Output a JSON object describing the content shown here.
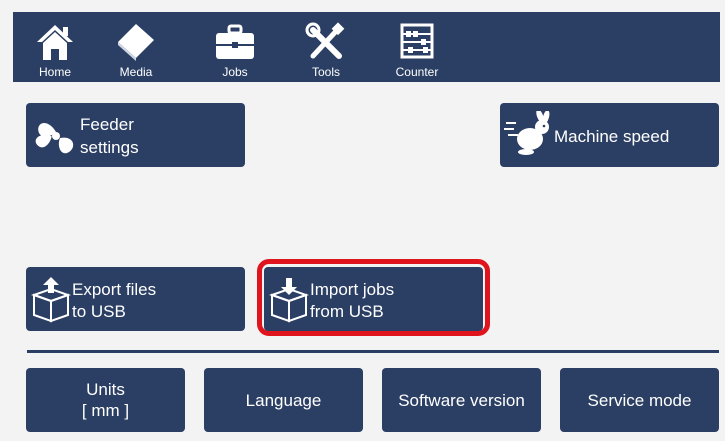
{
  "nav": {
    "home": "Home",
    "media": "Media",
    "jobs": "Jobs",
    "tools": "Tools",
    "counter": "Counter"
  },
  "buttons": {
    "feeder": {
      "line1": "Feeder",
      "line2": "settings"
    },
    "machine_speed": "Machine speed",
    "export": {
      "line1": "Export files",
      "line2": "to USB"
    },
    "import": {
      "line1": "Import jobs",
      "line2": "from USB"
    },
    "units": {
      "line1": "Units",
      "line2": "[ mm ]"
    },
    "language": "Language",
    "software_version": "Software version",
    "service_mode": "Service mode"
  },
  "colors": {
    "accent": "#2b3e63",
    "highlight": "#e0141c",
    "background": "#f3f3f3"
  }
}
